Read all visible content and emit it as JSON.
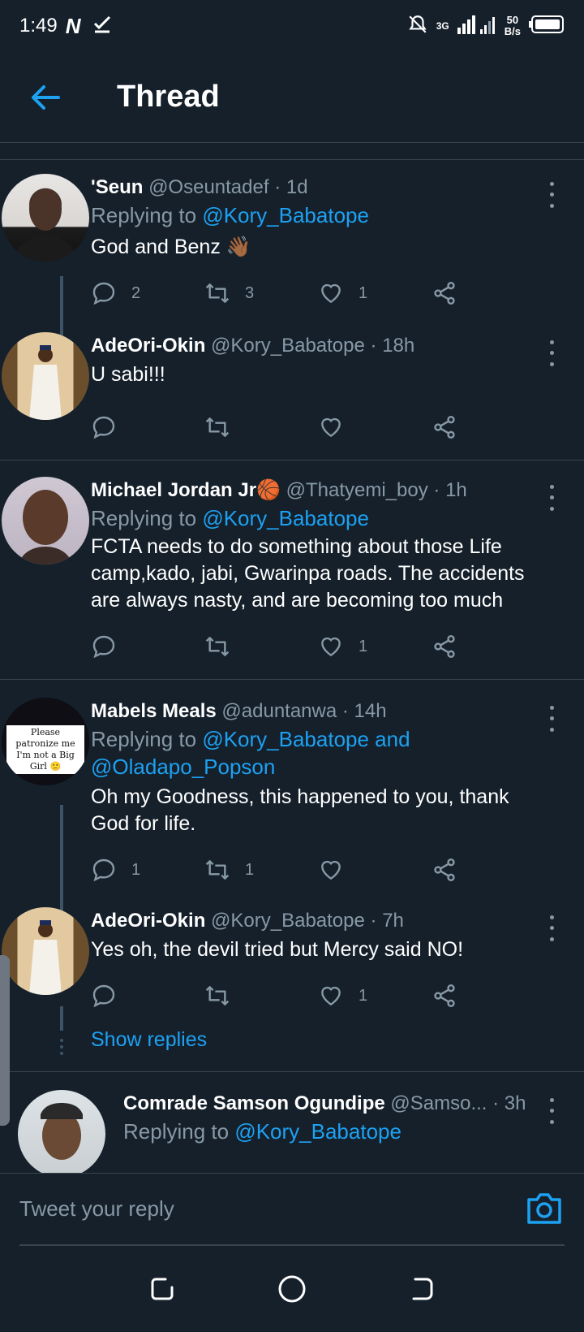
{
  "status_bar": {
    "time": "1:49",
    "net_speed": "50",
    "net_unit": "B/s",
    "network_type": "3G"
  },
  "header": {
    "title": "Thread"
  },
  "tweets": [
    {
      "name": "'Seun",
      "handle": "@Oseuntadef",
      "dot": "·",
      "ago": "1d",
      "reply_prefix": "Replying to ",
      "reply_to": "@Kory_Babatope",
      "text": "God and Benz 👋🏾",
      "replies": "2",
      "retweets": "3",
      "likes": "1"
    },
    {
      "name": "AdeOri-Okin",
      "handle": "@Kory_Babatope",
      "dot": "·",
      "ago": "18h",
      "text": "U sabi!!!",
      "replies": "",
      "retweets": "",
      "likes": ""
    },
    {
      "name": "Michael Jordan Jr🏀",
      "handle": "@Thatyemi_boy",
      "dot": "·",
      "ago": "1h",
      "reply_prefix": "Replying to ",
      "reply_to": "@Kory_Babatope",
      "text": "FCTA needs to do something about those Life camp,kado, jabi, Gwarinpa roads. The accidents are always nasty, and are becoming too much",
      "replies": "",
      "retweets": "",
      "likes": "1"
    },
    {
      "name": "Mabels Meals",
      "handle": "@aduntanwa",
      "dot": "·",
      "ago": "14h",
      "reply_prefix": "Replying to ",
      "reply_to": "@Kory_Babatope and @Oladapo_Popson",
      "text": "Oh my Goodness, this happened to you, thank God for life.",
      "avatar_text": "Please patronize me I'm not a Big Girl 🙂",
      "replies": "1",
      "retweets": "1",
      "likes": ""
    },
    {
      "name": "AdeOri-Okin",
      "handle": "@Kory_Babatope",
      "dot": "·",
      "ago": "7h",
      "text": "Yes oh, the devil tried but Mercy said NO!",
      "replies": "",
      "retweets": "",
      "likes": "1"
    },
    {
      "name": "Comrade Samson Ogundipe",
      "handle": "@Samso...",
      "dot": "·",
      "ago": "3h",
      "reply_prefix": "Replying to ",
      "reply_to": "@Kory_Babatope"
    }
  ],
  "show_replies": "Show replies",
  "reply_bar": {
    "placeholder": "Tweet your reply"
  },
  "colors": {
    "background": "#15202b",
    "accent": "#1da1f2",
    "muted": "#8899a6",
    "divider": "#38444d"
  }
}
